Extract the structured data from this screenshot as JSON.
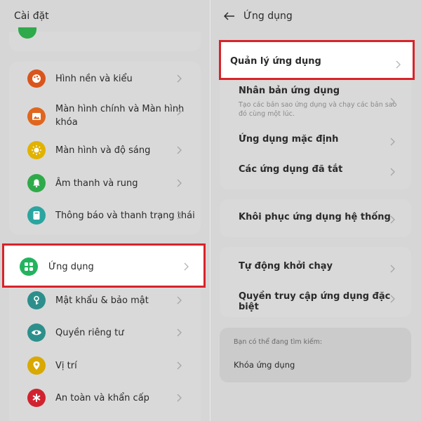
{
  "colors": {
    "highlight_border": "#d8232a",
    "icon_wallpaper": "#d9551c",
    "icon_home_screen": "#e0661e",
    "icon_display": "#e1b200",
    "icon_sound": "#2faa4a",
    "icon_notifications": "#2aa5a0",
    "icon_apps": "#23b35f",
    "icon_password": "#2d8f8c",
    "icon_privacy": "#2d8f8c",
    "icon_location": "#d9a900",
    "icon_safety": "#d0232f"
  },
  "left": {
    "header_title": "Cài đặt",
    "items": [
      {
        "label": "Hình nền và kiểu",
        "icon": "palette-icon"
      },
      {
        "label_line1": "Màn hình chính và Màn hình",
        "label_line2": "khóa",
        "icon": "image-icon"
      },
      {
        "label": "Màn hình và độ sáng",
        "icon": "sun-icon"
      },
      {
        "label": "Âm thanh và rung",
        "icon": "bell-icon"
      },
      {
        "label": "Thông báo và thanh trạng thái",
        "icon": "notification-icon"
      },
      {
        "label": "Ứng dụng",
        "icon": "apps-grid-icon"
      },
      {
        "label": "Mật khẩu & bảo mật",
        "icon": "key-icon"
      },
      {
        "label": "Quyền riêng tư",
        "icon": "eye-icon"
      },
      {
        "label": "Vị trí",
        "icon": "location-pin-icon"
      },
      {
        "label": "An toàn và khẩn cấp",
        "icon": "asterisk-icon"
      }
    ]
  },
  "right": {
    "header_title": "Ứng dụng",
    "items": [
      {
        "label": "Quản lý ứng dụng"
      },
      {
        "label": "Nhân bản ứng dụng",
        "sub": "Tạo các bản sao ứng dụng và chạy các bản sao đó cùng một lúc."
      },
      {
        "label": "Ứng dụng mặc định"
      },
      {
        "label": "Các ứng dụng đã tắt"
      },
      {
        "label": "Khôi phục ứng dụng hệ thống"
      },
      {
        "label": "Tự động khởi chạy"
      },
      {
        "label": "Quyền truy cập ứng dụng đặc biệt"
      }
    ],
    "search_hint": {
      "caption": "Bạn có thể đang tìm kiếm:",
      "item": "Khóa ứng dụng"
    }
  }
}
